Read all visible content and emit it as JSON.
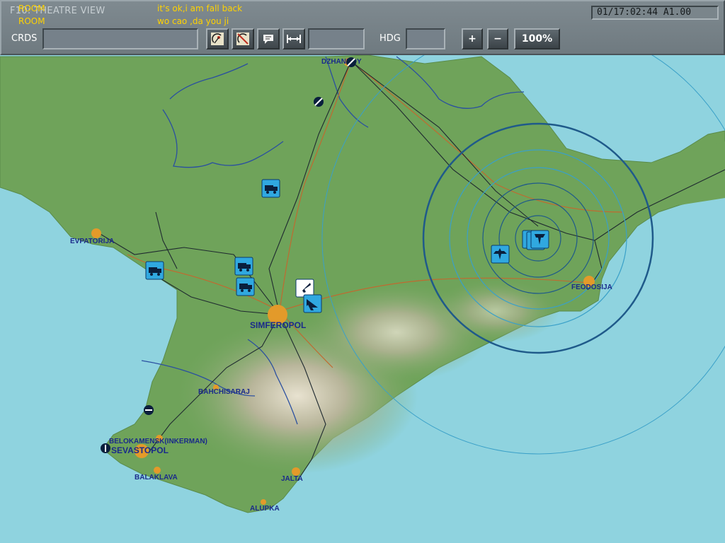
{
  "toolbar": {
    "title": "F10: THEATRE VIEW",
    "chat": [
      {
        "sender": "ROOM",
        "message": "it's ok,i am fall back"
      },
      {
        "sender": "ROOM",
        "message": "wo cao ,da you ji"
      }
    ],
    "clock": "01/17:02:44 A1.00",
    "crds_label": "CRDS",
    "crds_value": "",
    "distance_value": "",
    "hdg_label": "HDG",
    "hdg_value": "",
    "zoom_in_label": "+",
    "zoom_out_label": "−",
    "zoom_level": "100%",
    "tool_icons": [
      "radar-dish-icon",
      "radar-off-icon",
      "comment-icon",
      "measure-icon"
    ]
  },
  "map": {
    "colors": {
      "sea": "#8fd3df",
      "land": "#6fa35a",
      "roads": "#1f2a30",
      "rivers": "#2a4fa0",
      "rail": "#c06a30",
      "rings_dark": "#1f5a8a",
      "rings_light": "#3aa0c8",
      "unit": "#30a8e0"
    },
    "cities": [
      {
        "name": "DZHANKOY"
      },
      {
        "name": "EVPATORIJA"
      },
      {
        "name": "SIMFEROPOL"
      },
      {
        "name": "FEODOSIJA"
      },
      {
        "name": "BAHCHISARAJ"
      },
      {
        "name": "BELOKAMENSK(INKERMAN)"
      },
      {
        "name": "SEVASTOPOL"
      },
      {
        "name": "BALAKLAVA"
      },
      {
        "name": "JALTA"
      },
      {
        "name": "ALUPKA"
      }
    ]
  }
}
